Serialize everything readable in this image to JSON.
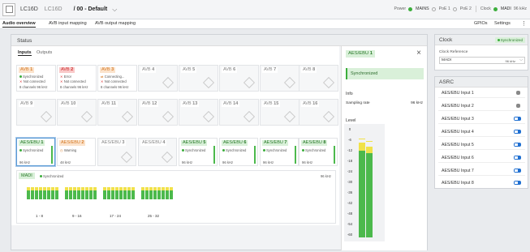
{
  "header": {
    "model": "LC16D",
    "name": "LC16D",
    "path": "/ 00 - Default",
    "chev": "⌵",
    "power_label": "Power",
    "mains": "MAINS",
    "poe1": "PoE 1",
    "poe2": "PoE 2",
    "clock_label": "Clock",
    "clock_src": "MADI",
    "clock_rate": "96 kHz"
  },
  "tabs": {
    "overview": "Audio overview",
    "input": "AVB input mapping",
    "output": "AVB output mapping",
    "gpios": "GPIOs",
    "settings": "Settings",
    "kebab": "⋮"
  },
  "status": {
    "title": "Status",
    "inputs": "Inputs",
    "outputs": "Outputs"
  },
  "avb_row1": [
    {
      "label": "AVB",
      "num": "1",
      "lines": [
        "Synchronized",
        "Not connected",
        "8 channels  96 kHz"
      ],
      "kind": "orange"
    },
    {
      "label": "AVB",
      "num": "2",
      "lines": [
        "Error",
        "Not connected",
        "8 channels  96 kHz"
      ],
      "kind": "red"
    },
    {
      "label": "AVB",
      "num": "3",
      "lines": [
        "Connecting...",
        "Not connected",
        "8 channels  96 kHz"
      ],
      "kind": "orange"
    },
    {
      "label": "AVB",
      "num": "4"
    },
    {
      "label": "AVB",
      "num": "5"
    },
    {
      "label": "AVB",
      "num": "6"
    },
    {
      "label": "AVB",
      "num": "7"
    },
    {
      "label": "AVB",
      "num": "8"
    }
  ],
  "avb_row2": [
    {
      "label": "AVB",
      "num": "9"
    },
    {
      "label": "AVB",
      "num": "10"
    },
    {
      "label": "AVB",
      "num": "11"
    },
    {
      "label": "AVB",
      "num": "12"
    },
    {
      "label": "AVB",
      "num": "13"
    },
    {
      "label": "AVB",
      "num": "14"
    },
    {
      "label": "AVB",
      "num": "15"
    },
    {
      "label": "AVB",
      "num": "16"
    }
  ],
  "aes_cards": [
    {
      "label": "AES/EBU",
      "num": "1",
      "status": "Synchronized",
      "rate": "96 kHz"
    },
    {
      "label": "AES/EBU",
      "num": "2",
      "status": "Warning",
      "rate": "48 kHz"
    },
    {
      "label": "AES/EBU",
      "num": "3",
      "status": "",
      "rate": ""
    },
    {
      "label": "AES/EBU",
      "num": "4",
      "status": "",
      "rate": ""
    },
    {
      "label": "AES/EBU",
      "num": "5",
      "status": "Synchronized",
      "rate": "96 kHz"
    },
    {
      "label": "AES/EBU",
      "num": "6",
      "status": "Synchronized",
      "rate": "96 kHz"
    },
    {
      "label": "AES/EBU",
      "num": "7",
      "status": "Synchronized",
      "rate": "96 kHz"
    },
    {
      "label": "AES/EBU",
      "num": "8",
      "status": "Synchronized",
      "rate": "96 kHz"
    }
  ],
  "madi": {
    "label": "MADI",
    "status": "Synchronized",
    "rate": "96 kHz",
    "groups": [
      "1 - 8",
      "9 - 16",
      "17 - 24",
      "25 - 32"
    ]
  },
  "detail": {
    "title": "AES/EBU",
    "num": "1",
    "close": "×",
    "state": "Synchronized",
    "info": "Info",
    "sr_label": "Sampling rate",
    "sr_value": "96 kHz",
    "level": "Level",
    "scale": [
      "0",
      "-6",
      "-12",
      "-18",
      "-24",
      "-30",
      "-36",
      "-42",
      "-48",
      "-54",
      "-60"
    ]
  },
  "clock": {
    "title": "Clock",
    "badge": "Synchronized",
    "ref_label": "Clock Reference",
    "ref_value": "MADI",
    "ref_rate": "96 kHz"
  },
  "asrc": {
    "title": "ASRC",
    "items": [
      {
        "label": "AES/EBU Input 1",
        "on": false
      },
      {
        "label": "AES/EBU Input 2",
        "on": false
      },
      {
        "label": "AES/EBU Input 3",
        "on": true
      },
      {
        "label": "AES/EBU Input 4",
        "on": true
      },
      {
        "label": "AES/EBU Input 5",
        "on": true
      },
      {
        "label": "AES/EBU Input 6",
        "on": true
      },
      {
        "label": "AES/EBU Input 7",
        "on": true
      },
      {
        "label": "AES/EBU Input 8",
        "on": true
      }
    ]
  }
}
